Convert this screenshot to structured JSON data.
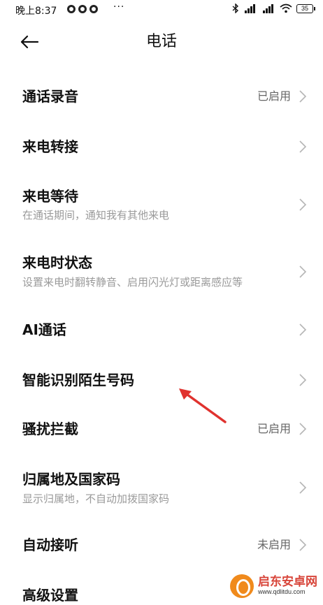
{
  "status_bar": {
    "time": "晚上8:37",
    "more": "···",
    "battery": "35"
  },
  "header": {
    "title": "电话"
  },
  "items": [
    {
      "title": "通话录音",
      "status": "已启用"
    },
    {
      "title": "来电转接"
    },
    {
      "title": "来电等待",
      "subtitle": "在通话期间，通知我有其他来电"
    },
    {
      "title": "来电时状态",
      "subtitle": "设置来电时翻转静音、启用闪光灯或距离感应等"
    },
    {
      "title": "AI通话"
    },
    {
      "title": "智能识别陌生号码"
    },
    {
      "title": "骚扰拦截",
      "status": "已启用"
    },
    {
      "title": "归属地及国家码",
      "subtitle": "显示归属地，不自动加拨国家码"
    },
    {
      "title": "自动接听",
      "status": "未启用"
    },
    {
      "title": "高级设置"
    }
  ],
  "annotation": {
    "arrow_color": "#e0322e"
  },
  "watermark": {
    "title": "启东安卓网",
    "url": "www.qdlitdu.com"
  }
}
